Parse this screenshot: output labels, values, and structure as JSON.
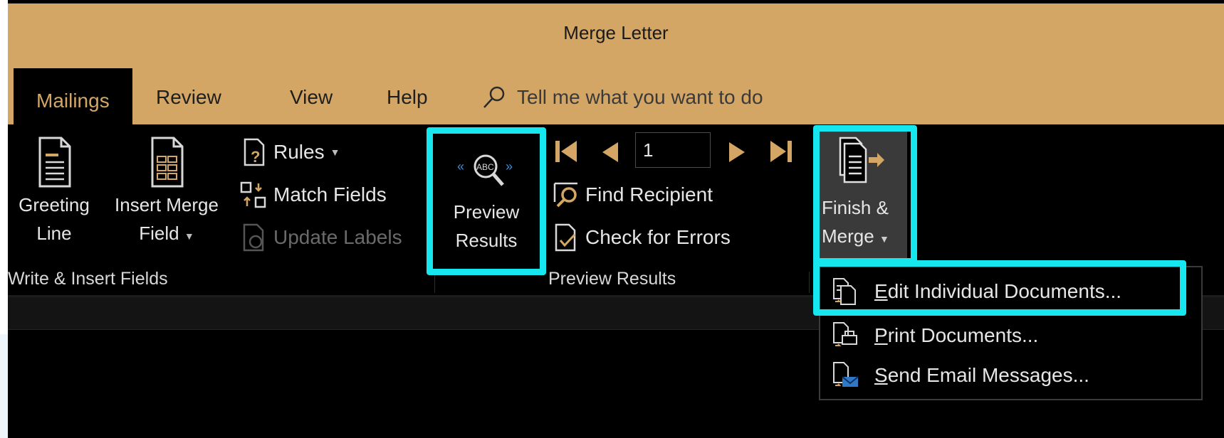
{
  "window": {
    "title": "Merge Letter"
  },
  "tabs": [
    {
      "label": "Mailings"
    },
    {
      "label": "Review"
    },
    {
      "label": "View"
    },
    {
      "label": "Help"
    }
  ],
  "tell_me": {
    "placeholder": "Tell me what you want to do"
  },
  "write_insert": {
    "greeting_line": [
      "Greeting",
      "Line"
    ],
    "insert_merge_field": [
      "Insert Merge",
      "Field"
    ],
    "rules": "Rules",
    "match_fields": "Match Fields",
    "update_labels": "Update Labels",
    "group_label": "Write & Insert Fields"
  },
  "preview": {
    "preview_results": [
      "Preview",
      "Results"
    ],
    "record_number": "1",
    "find_recipient": "Find Recipient",
    "check_errors": "Check for Errors",
    "group_label": "Preview Results"
  },
  "finish": {
    "finish_merge": [
      "Finish &",
      "Merge"
    ]
  },
  "dropdown_menu": {
    "items": [
      {
        "accel": "E",
        "rest": "dit Individual Documents..."
      },
      {
        "accel": "P",
        "rest": "rint Documents..."
      },
      {
        "accel": "S",
        "rest": "end Email Messages..."
      }
    ]
  },
  "colors": {
    "titlebar": "#d4a665",
    "ribbon": "#000000",
    "highlight": "#16e6ee",
    "text": "#e6e6e6"
  },
  "icons": [
    "greeting-line-icon",
    "insert-merge-field-icon",
    "rules-icon",
    "match-fields-icon",
    "update-labels-icon",
    "preview-results-icon",
    "first-record-icon",
    "previous-record-icon",
    "next-record-icon",
    "last-record-icon",
    "find-recipient-icon",
    "check-errors-icon",
    "finish-merge-icon",
    "edit-documents-icon",
    "print-documents-icon",
    "send-email-icon",
    "search-icon"
  ]
}
